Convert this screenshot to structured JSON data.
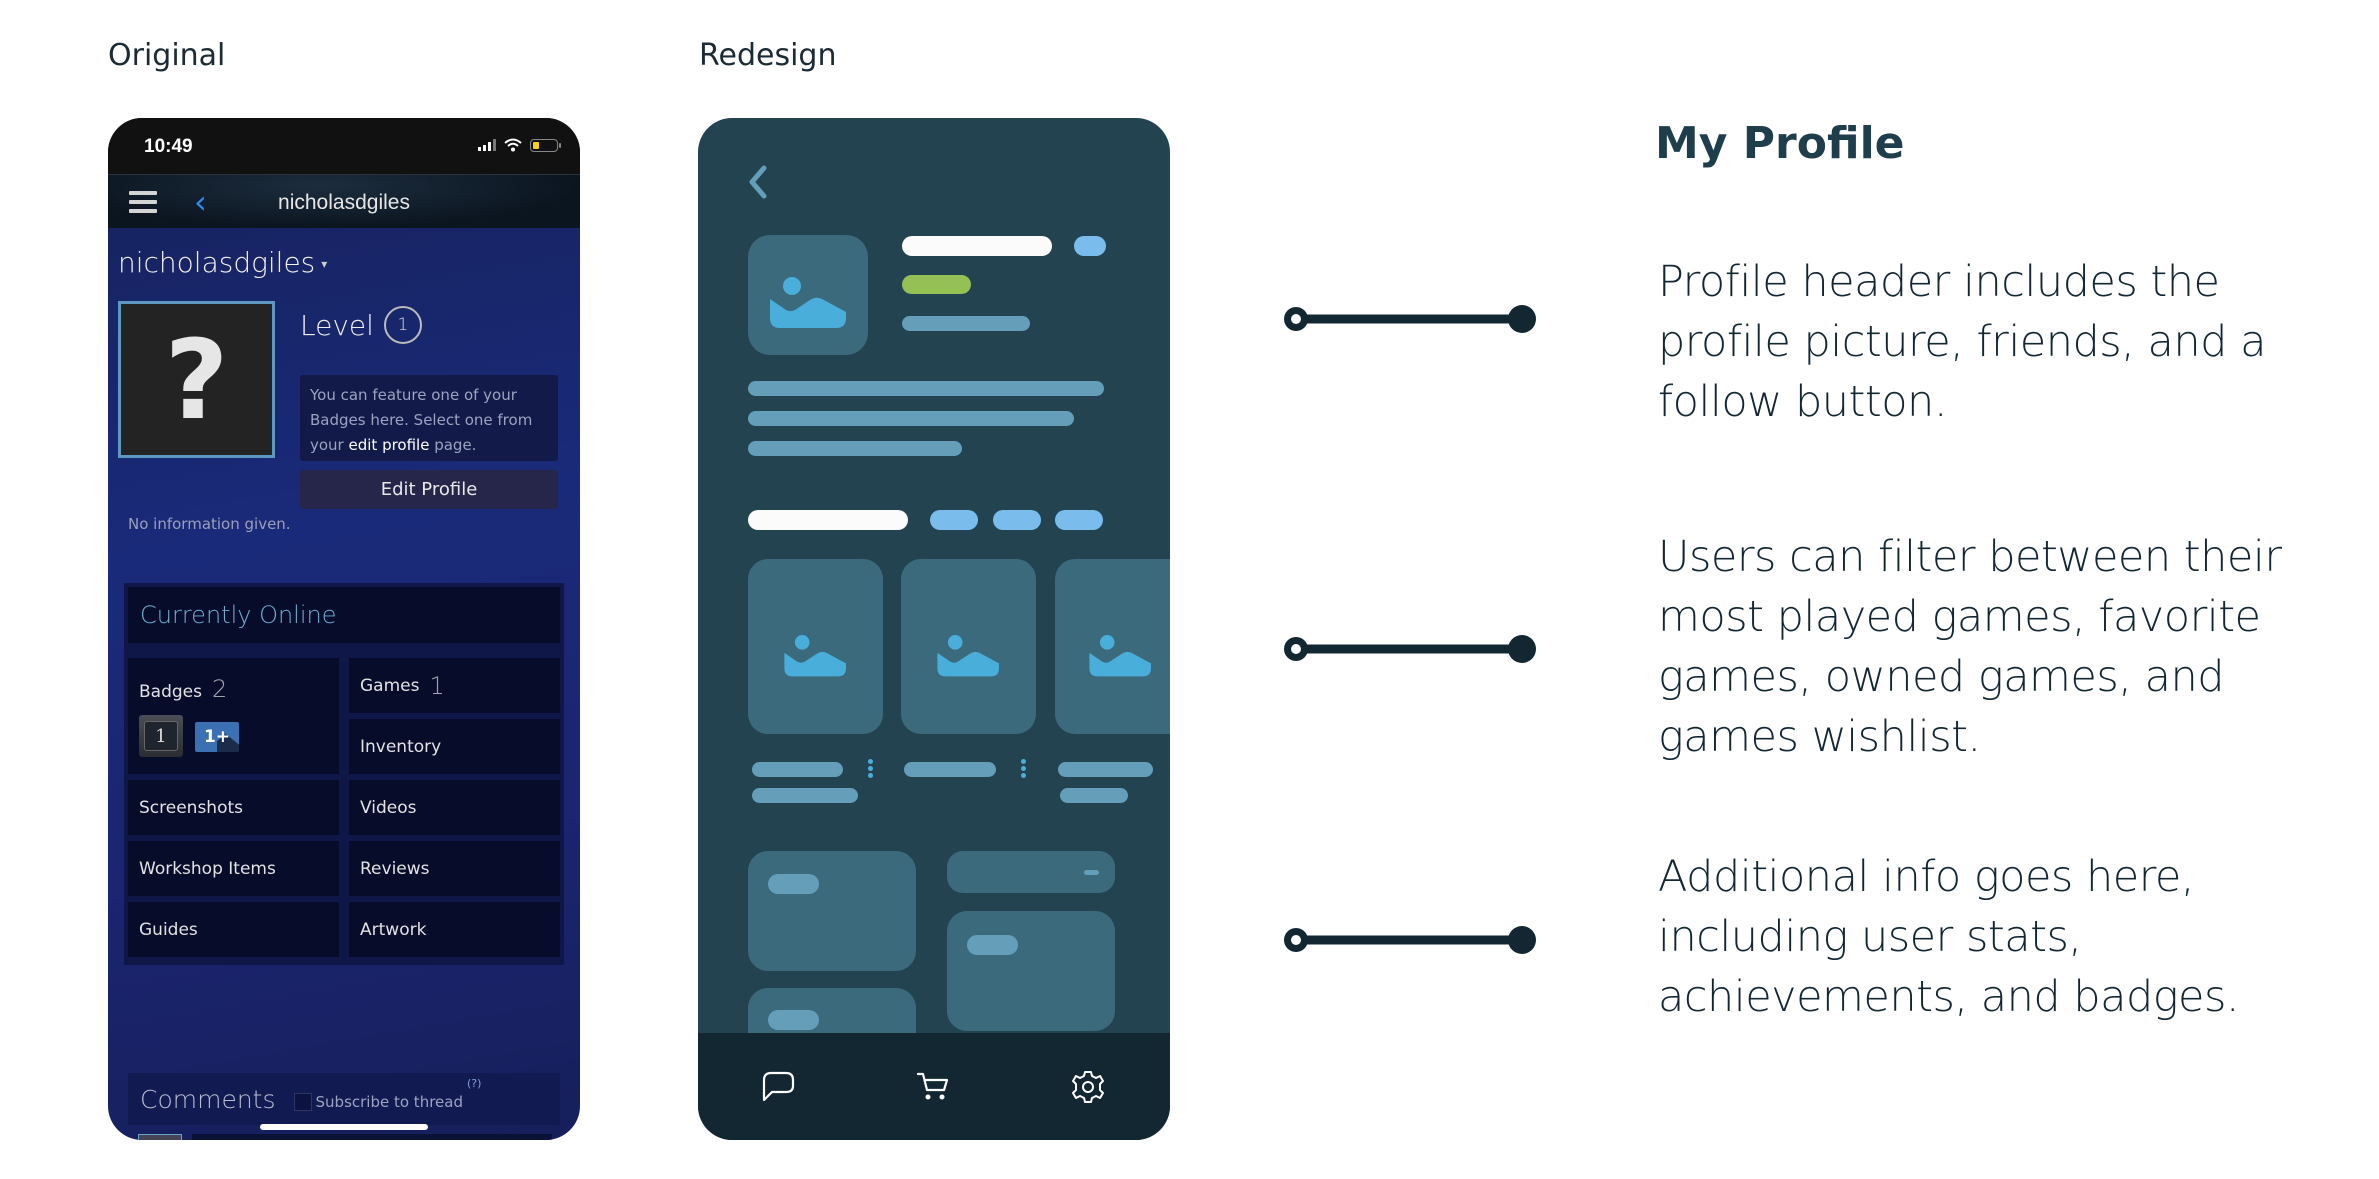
{
  "labels": {
    "original": "Original",
    "redesign": "Redesign"
  },
  "original": {
    "status_bar": {
      "time": "10:49",
      "icons": [
        "signal-icon",
        "wifi-icon",
        "battery-low-icon"
      ]
    },
    "nav": {
      "menu_icon": "hamburger-icon",
      "back_icon": "chevron-left-icon",
      "title": "nicholasdgiles"
    },
    "profile": {
      "username": "nicholasdgiles",
      "username_caret": "▾",
      "avatar_placeholder": "?",
      "level_label": "Level",
      "level_value": "1",
      "feature_text_before": "You can feature one of your Badges here. Select one from your ",
      "feature_link": "edit profile",
      "feature_text_after": " page.",
      "edit_button": "Edit Profile",
      "summary": "No information given."
    },
    "stats": {
      "status": "Currently Online",
      "badges_label": "Badges",
      "badges_count": "2",
      "badge_items": [
        "1",
        "1+"
      ],
      "games_label": "Games",
      "games_count": "1",
      "links": [
        "Inventory",
        "Screenshots",
        "Videos",
        "Workshop Items",
        "Reviews",
        "Guides",
        "Artwork"
      ]
    },
    "comments": {
      "title": "Comments",
      "subscribe_label": "Subscribe to thread",
      "subscribe_checked": false,
      "help": "(?)"
    }
  },
  "redesign": {
    "colors": {
      "background": "#234350",
      "tile": "#3c6a7d",
      "muted": "#649eb9",
      "accent_blue": "#7abdec",
      "accent_green": "#95c056",
      "icon_blue": "#4aaedb",
      "tabbar": "#132733"
    },
    "back_icon": "chevron-left-icon",
    "tabbar_icons": [
      "chat-icon",
      "cart-icon",
      "settings-gear-icon"
    ]
  },
  "annotations": {
    "title": "My Profile",
    "notes": [
      "Profile header includes the profile picture, friends, and a follow button.",
      "Users can filter between their most played games, favorite games, owned games, and games wishlist.",
      "Additional info goes here, including user stats, achievements, and badges."
    ]
  }
}
